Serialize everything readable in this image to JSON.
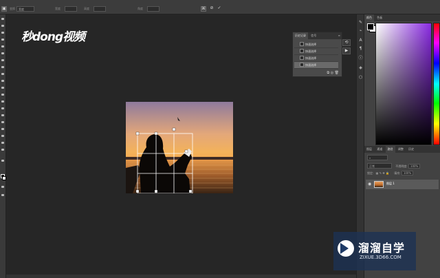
{
  "watermark_top": {
    "text": "秒dong视频"
  },
  "options_bar": {
    "mode_label": "变换",
    "mode_value": "宽度",
    "field1_label": "宽度",
    "field2_label": "高度",
    "field3_label": "角度",
    "commit_icon": "check-icon",
    "cancel_icon": "no-icon"
  },
  "history_panel": {
    "tabs": [
      "历史记录",
      "信号"
    ],
    "items": [
      "快速选择",
      "快速选择",
      "快速选择",
      "快速选择"
    ],
    "selected_index": 3
  },
  "color_panel": {
    "tabs": [
      "颜色",
      "色板"
    ],
    "foreground": "#000000",
    "background": "#ffffff"
  },
  "layers_panel": {
    "tabs": [
      "图层",
      "通道",
      "路径",
      "调整",
      "历史"
    ],
    "active_tab": "路径",
    "blend_mode": "正常",
    "opacity_label": "不透明度:",
    "opacity_value": "100%",
    "lock_label": "锁定:",
    "fill_label": "填充:",
    "fill_value": "100%",
    "layer_name": "图层 1"
  },
  "zixue_watermark": {
    "title": "溜溜自学",
    "url": "ZIXUE.3D66.COM"
  }
}
